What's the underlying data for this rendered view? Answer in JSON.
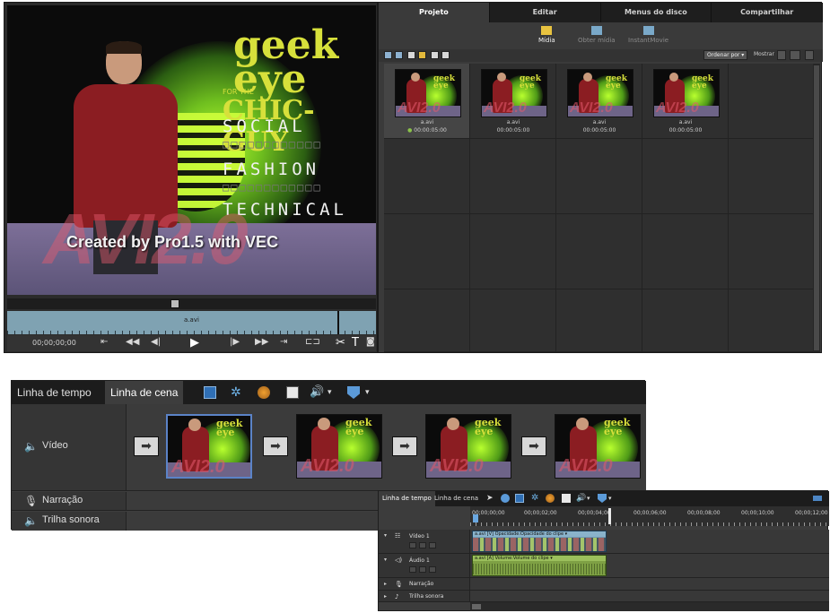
{
  "monitor": {
    "brand_line1": "geek",
    "brand_line2": "eye",
    "brand_small": "FOR THE",
    "brand_line3": "CHIC-GUY",
    "categories": [
      "SOCIAL",
      "FASHION",
      "TECHNICAL"
    ],
    "watermark": "AVI2.0",
    "watermark_caption": "Created by Pro1.5 with VEC",
    "track_clip_label": "a.avi",
    "timecode": "00;00;00;00"
  },
  "project": {
    "tabs": [
      {
        "label": "Projeto",
        "active": true
      },
      {
        "label": "Editar",
        "active": false
      },
      {
        "label": "Menus do disco",
        "active": false
      },
      {
        "label": "Compartilhar",
        "active": false
      }
    ],
    "subtabs": [
      {
        "label": "Mídia",
        "active": true
      },
      {
        "label": "Obter mídia",
        "active": false
      },
      {
        "label": "InstantMovie",
        "active": false
      }
    ],
    "sort_label": "Ordenar por",
    "show_label": "Mostrar",
    "clips": [
      {
        "name": "a.avi",
        "duration": "00:00:05:00",
        "selected": true
      },
      {
        "name": "a.avi",
        "duration": "00:00:05:00",
        "selected": false
      },
      {
        "name": "a.avi",
        "duration": "00:00:05:00",
        "selected": false
      },
      {
        "name": "a.avi",
        "duration": "00:00:05:00",
        "selected": false
      }
    ]
  },
  "scene": {
    "tab_timeline": "Linha de tempo",
    "tab_scene": "Linha de cena",
    "video_label": "Vídeo",
    "narration_label": "Narração",
    "music_label": "Trilha sonora",
    "clip_caption": "Created by Pro1.5 with VEC",
    "clip_watermark": "AVI2.0",
    "clip_count": 4
  },
  "timeline": {
    "tab_timeline": "Linha de tempo",
    "tab_scene": "Linha de cena",
    "ruler": [
      "00;00;00;00",
      "00;00;02;00",
      "00;00;04;00",
      "00;00;06;00",
      "00;00;08;00",
      "00;00;10;00",
      "00;00;12;00"
    ],
    "tracks": [
      {
        "name": "Vídeo 1",
        "clip": "a.avi [V] Opacidade:Opacidade do clipe ▾"
      },
      {
        "name": "Áudio 1",
        "clip": "a.avi [A] Volume:Volume do clipe ▾"
      },
      {
        "name": "Narração"
      },
      {
        "name": "Trilha sonora"
      }
    ]
  },
  "colors": {
    "panel_dark": "#1c1c1c",
    "panel_mid": "#3a3a3a",
    "selection_blue": "#5b83c7",
    "video_clip": "#6f9ab5",
    "audio_clip": "#7ea044",
    "brand_yellow": "#d7e03b"
  }
}
